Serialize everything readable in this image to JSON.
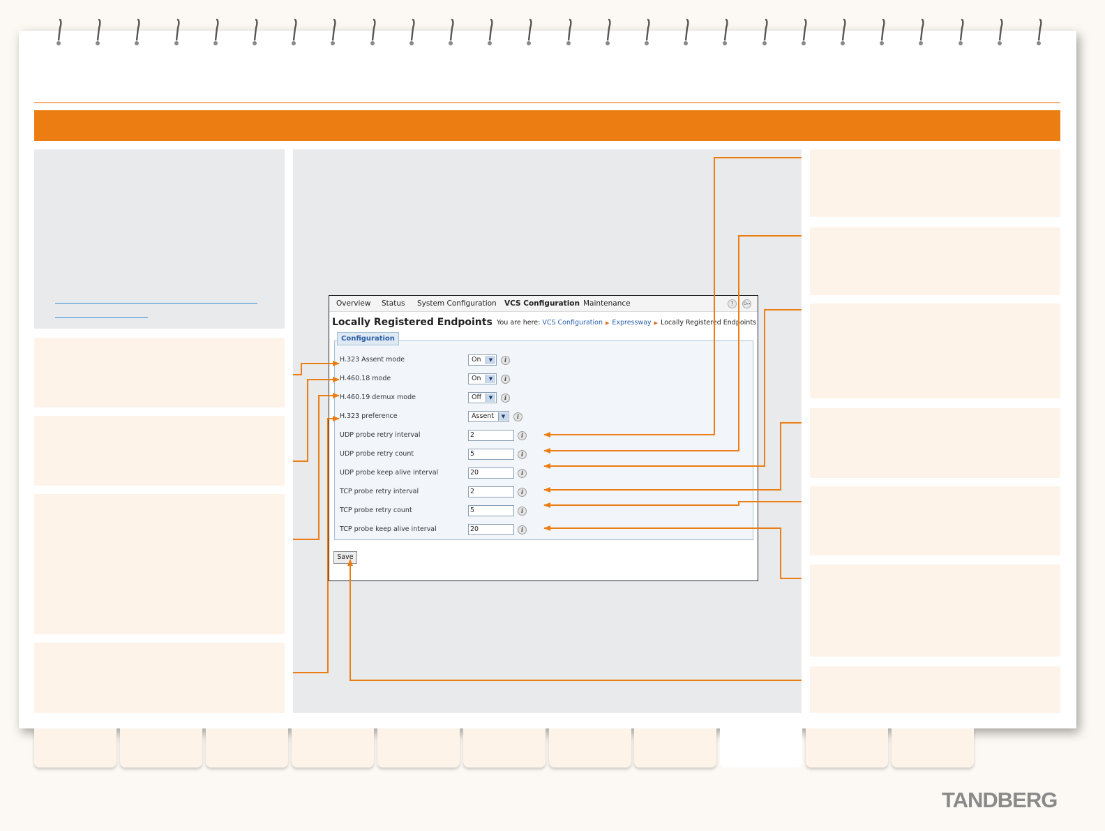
{
  "window": {
    "menu": {
      "overview": "Overview",
      "status": "Status",
      "system_configuration": "System Configuration",
      "vcs_configuration": "VCS Configuration",
      "maintenance": "Maintenance"
    },
    "help_icon": "?",
    "logout_icon": "O↦",
    "page_title": "Locally Registered Endpoints",
    "breadcrumb": {
      "prefix": "You are here:",
      "item1": "VCS Configuration",
      "item2": "Expressway",
      "item3": "Locally Registered Endpoints"
    },
    "section_tab": "Configuration",
    "fields": {
      "h323_assent_mode": {
        "label": "H.323 Assent mode",
        "value": "On"
      },
      "h46018_mode": {
        "label": "H.460.18 mode",
        "value": "On"
      },
      "h46019_demux_mode": {
        "label": "H.460.19 demux mode",
        "value": "Off"
      },
      "h323_preference": {
        "label": "H.323 preference",
        "value": "Assent"
      },
      "udp_probe_retry_interval": {
        "label": "UDP probe retry interval",
        "value": "2"
      },
      "udp_probe_retry_count": {
        "label": "UDP probe retry count",
        "value": "5"
      },
      "udp_probe_keep_alive_interval": {
        "label": "UDP probe keep alive interval",
        "value": "20"
      },
      "tcp_probe_retry_interval": {
        "label": "TCP probe retry interval",
        "value": "2"
      },
      "tcp_probe_retry_count": {
        "label": "TCP probe retry count",
        "value": "5"
      },
      "tcp_probe_keep_alive_interval": {
        "label": "TCP probe keep alive interval",
        "value": "20"
      }
    },
    "info_glyph": "i",
    "dropdown_glyph": "▼",
    "save_label": "Save"
  },
  "brand": "TANDBERG",
  "colors": {
    "accent": "#eb7d13",
    "panel_gray": "#e9eaec",
    "note_box": "#fdf3e9",
    "link": "#2b5fa8"
  }
}
